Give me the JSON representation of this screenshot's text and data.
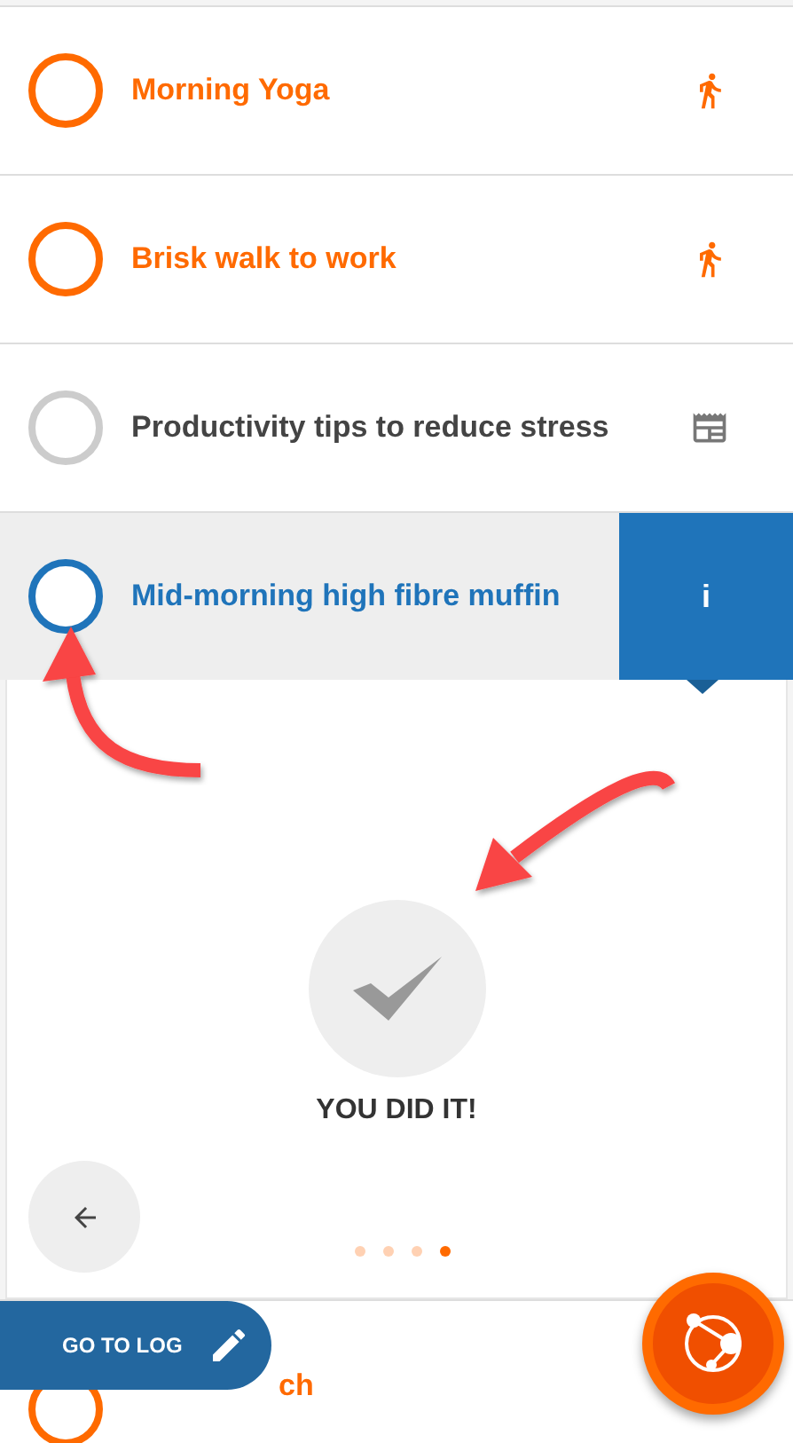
{
  "items": [
    {
      "title": "Morning Yoga",
      "color": "#ff6a00",
      "kind": "activity",
      "selected": false
    },
    {
      "title": "Brisk walk to work",
      "color": "#ff6a00",
      "kind": "activity",
      "selected": false
    },
    {
      "title": "Productivity tips to reduce stress",
      "color": "#cccccc",
      "kind": "article",
      "selected": false
    },
    {
      "title": "Mid-morning high fibre muffin",
      "color": "#1f74ba",
      "selected": true
    }
  ],
  "info_tab": {
    "label": "i"
  },
  "panel": {
    "message": "YOU DID IT!",
    "pages": [
      {
        "selected": false
      },
      {
        "selected": false
      },
      {
        "selected": false
      },
      {
        "selected": true
      }
    ]
  },
  "partial_item": {
    "title": "ch",
    "color": "#ff6a00"
  },
  "go_to_log": {
    "label": "GO TO LOG"
  }
}
